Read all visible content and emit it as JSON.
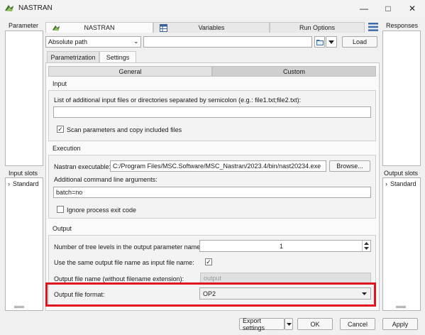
{
  "window": {
    "title": "NASTRAN"
  },
  "left_panel": {
    "parameter_label": "Parameter",
    "input_slots_label": "Input slots",
    "input_slot_items": [
      "Standard"
    ]
  },
  "right_panel": {
    "responses_label": "Responses",
    "output_slots_label": "Output slots",
    "output_slot_items": [
      "Standard"
    ]
  },
  "top_tabs": {
    "nastran": "NASTRAN",
    "variables": "Variables",
    "run_options": "Run Options"
  },
  "path_row": {
    "path_mode": "Absolute path",
    "path_value": "",
    "load_label": "Load"
  },
  "sub_tabs": {
    "parametrization": "Parametrization",
    "settings": "Settings"
  },
  "settings_tabs": {
    "general": "General",
    "custom": "Custom"
  },
  "input_group": {
    "title": "Input",
    "additional_files_label": "List of additional input files or directories separated by semicolon (e.g.: file1.txt;file2.txt):",
    "additional_files_value": "",
    "scan_params_label": "Scan parameters and copy included files",
    "scan_params_checked": true
  },
  "execution_group": {
    "title": "Execution",
    "executable_label": "Nastran executable:",
    "executable_value": "C:/Program Files/MSC.Software/MSC_Nastran/2023.4/bin/nast20234.exe",
    "browse_label": "Browse...",
    "args_label": "Additional command line arguments:",
    "args_value": "batch=no",
    "ignore_exit_label": "Ignore process exit code",
    "ignore_exit_checked": false
  },
  "output_group": {
    "title": "Output",
    "tree_levels_label": "Number of tree levels in the output parameter name:",
    "tree_levels_value": "1",
    "same_name_label": "Use the same output file name as input file name:",
    "same_name_checked": true,
    "file_name_label": "Output file name (without filename extension):",
    "file_name_placeholder": "output",
    "format_label": "Output file format:",
    "format_value": "OP2"
  },
  "highlight_color": "#e0141e",
  "bottom_buttons": {
    "export_settings": "Export settings",
    "ok": "OK",
    "cancel": "Cancel",
    "apply": "Apply"
  }
}
